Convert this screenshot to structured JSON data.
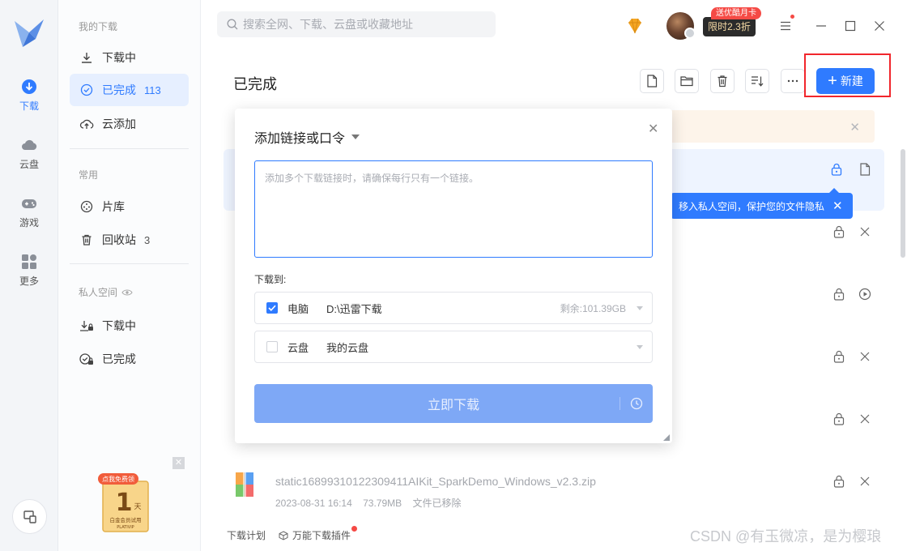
{
  "rail": {
    "items": [
      {
        "label": "下载"
      },
      {
        "label": "云盘"
      },
      {
        "label": "游戏"
      },
      {
        "label": "更多"
      }
    ]
  },
  "sidebar": {
    "section_my": "我的下载",
    "downloading": "下载中",
    "completed": "已完成",
    "completed_count": "113",
    "cloud_add": "云添加",
    "section_common": "常用",
    "library": "片库",
    "recycle": "回收站",
    "recycle_count": "3",
    "section_private": "私人空间",
    "private_downloading": "下载中",
    "private_completed": "已完成"
  },
  "topbar": {
    "search_placeholder": "搜索全网、下载、云盘或收藏地址",
    "vip_popup": "送优酷月卡",
    "vip_tag": "限时2.3折"
  },
  "content": {
    "title": "已完成",
    "new_label": "新建",
    "tooltip": "移入私人空间，保护您的文件隐私"
  },
  "modal": {
    "title": "添加链接或口令",
    "textarea_placeholder": "添加多个下载链接时，请确保每行只有一个链接。",
    "download_to": "下载到:",
    "dest_pc_name": "电脑",
    "dest_pc_path": "D:\\迅雷下载",
    "dest_pc_free": "剩余:101.39GB",
    "dest_cloud_name": "云盘",
    "dest_cloud_path": "我的云盘",
    "download_now": "立即下载"
  },
  "file": {
    "name": "static16899310122309411AIKit_SparkDemo_Windows_v2.3.zip",
    "date": "2023-08-31 16:14",
    "size": "73.79MB",
    "status": "文件已移除"
  },
  "footer": {
    "plan": "下载计划",
    "plugin": "万能下载插件"
  },
  "promo": {
    "top": "点我免费领",
    "num": "1",
    "unit": "天",
    "sub": "白金会员试用",
    "brand": "PLATIVIP"
  },
  "watermark": "CSDN @有玉微凉，是为樱琅",
  "colors": {
    "accent": "#2f7bff",
    "highlight_box": "#f1262c"
  }
}
